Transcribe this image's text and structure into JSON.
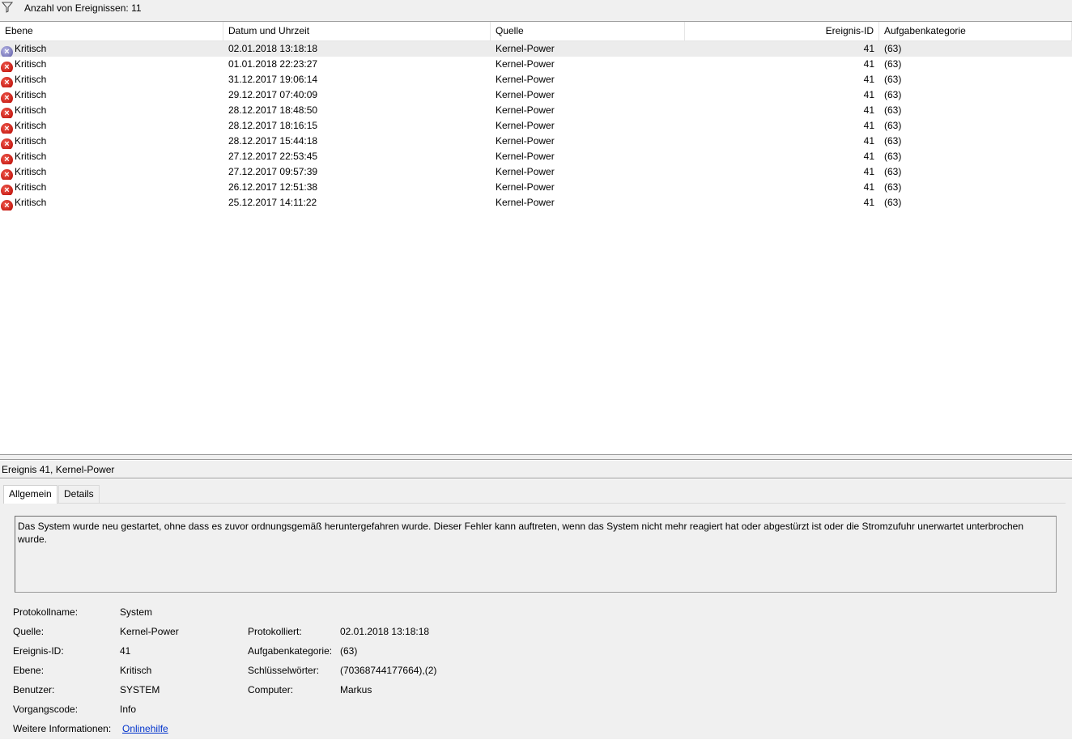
{
  "filter_bar": {
    "text": "Anzahl von Ereignissen: 11",
    "icon": "filter-icon"
  },
  "columns": {
    "level": "Ebene",
    "datetime": "Datum und Uhrzeit",
    "source": "Quelle",
    "event_id": "Ereignis-ID",
    "task_category": "Aufgabenkategorie"
  },
  "events": [
    {
      "level": "Kritisch",
      "datetime": "02.01.2018 13:18:18",
      "source": "Kernel-Power",
      "event_id": "41",
      "task_category": "(63)"
    },
    {
      "level": "Kritisch",
      "datetime": "01.01.2018 22:23:27",
      "source": "Kernel-Power",
      "event_id": "41",
      "task_category": "(63)"
    },
    {
      "level": "Kritisch",
      "datetime": "31.12.2017 19:06:14",
      "source": "Kernel-Power",
      "event_id": "41",
      "task_category": "(63)"
    },
    {
      "level": "Kritisch",
      "datetime": "29.12.2017 07:40:09",
      "source": "Kernel-Power",
      "event_id": "41",
      "task_category": "(63)"
    },
    {
      "level": "Kritisch",
      "datetime": "28.12.2017 18:48:50",
      "source": "Kernel-Power",
      "event_id": "41",
      "task_category": "(63)"
    },
    {
      "level": "Kritisch",
      "datetime": "28.12.2017 18:16:15",
      "source": "Kernel-Power",
      "event_id": "41",
      "task_category": "(63)"
    },
    {
      "level": "Kritisch",
      "datetime": "28.12.2017 15:44:18",
      "source": "Kernel-Power",
      "event_id": "41",
      "task_category": "(63)"
    },
    {
      "level": "Kritisch",
      "datetime": "27.12.2017 22:53:45",
      "source": "Kernel-Power",
      "event_id": "41",
      "task_category": "(63)"
    },
    {
      "level": "Kritisch",
      "datetime": "27.12.2017 09:57:39",
      "source": "Kernel-Power",
      "event_id": "41",
      "task_category": "(63)"
    },
    {
      "level": "Kritisch",
      "datetime": "26.12.2017 12:51:38",
      "source": "Kernel-Power",
      "event_id": "41",
      "task_category": "(63)"
    },
    {
      "level": "Kritisch",
      "datetime": "25.12.2017 14:11:22",
      "source": "Kernel-Power",
      "event_id": "41",
      "task_category": "(63)"
    }
  ],
  "detail": {
    "title": "Ereignis 41, Kernel-Power",
    "tabs": [
      "Allgemein",
      "Details"
    ],
    "description": "Das System wurde neu gestartet, ohne dass es zuvor ordnungsgemäß heruntergefahren wurde. Dieser Fehler kann auftreten, wenn das System nicht mehr reagiert hat oder abgestürzt ist oder die Stromzufuhr unerwartet unterbrochen wurde.",
    "labels": {
      "log_name": "Protokollname:",
      "source": "Quelle:",
      "event_id": "Ereignis-ID:",
      "level": "Ebene:",
      "user": "Benutzer:",
      "opcode": "Vorgangscode:",
      "more_info": "Weitere Informationen:",
      "logged": "Protokolliert:",
      "task_category": "Aufgabenkategorie:",
      "keywords": "Schlüsselwörter:",
      "computer": "Computer:"
    },
    "values": {
      "log_name": "System",
      "source": "Kernel-Power",
      "event_id": "41",
      "level": "Kritisch",
      "user": "SYSTEM",
      "opcode": "Info",
      "more_info": "Onlinehilfe",
      "logged": "02.01.2018 13:18:18",
      "task_category": "(63)",
      "keywords": "(70368744177664),(2)",
      "computer": "Markus"
    }
  },
  "colors": {
    "critical": "#c41a13",
    "selected_row": "#ececec",
    "link": "#0033cc"
  }
}
